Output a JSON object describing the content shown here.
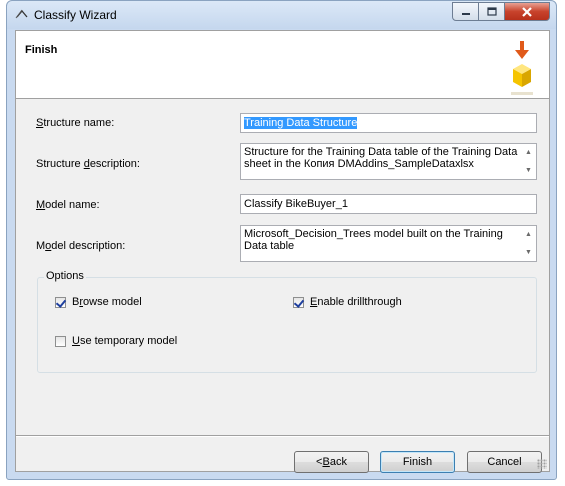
{
  "window": {
    "title": "Classify Wizard"
  },
  "page": {
    "title": "Finish"
  },
  "fields": {
    "structure_name": {
      "label_u": "S",
      "label_rest": "tructure name:",
      "value": "Training Data Structure"
    },
    "structure_description": {
      "label_pre": "Structure ",
      "label_u": "d",
      "label_rest": "escription:",
      "value": "Structure for the Training Data table of the Training Data sheet in the Копия DMAddins_SampleDataxlsx"
    },
    "model_name": {
      "label_u": "M",
      "label_rest": "odel name:",
      "value": "Classify BikeBuyer_1"
    },
    "model_description": {
      "label_pre": "M",
      "label_u": "o",
      "label_rest": "del description:",
      "value": "Microsoft_Decision_Trees model built on the Training Data table"
    }
  },
  "options": {
    "legend": "Options",
    "browse_model": {
      "label_pre": "B",
      "label_u": "r",
      "label_rest": "owse model",
      "checked": true
    },
    "enable_drillthrough": {
      "label_u": "E",
      "label_rest": "nable drillthrough",
      "checked": true
    },
    "use_temporary_model": {
      "label_u": "U",
      "label_rest": "se temporary model",
      "checked": false
    }
  },
  "buttons": {
    "back": {
      "label_pre": "< ",
      "label_u": "B",
      "label_rest": "ack"
    },
    "finish": {
      "label": "Finish"
    },
    "cancel": {
      "label": "Cancel"
    }
  },
  "icons": [
    "wizard-app-icon",
    "minimize-icon",
    "maximize-icon",
    "close-icon",
    "finish-arrow-cube-icon",
    "scroll-up-icon",
    "scroll-down-icon",
    "checkmark-icon",
    "resize-grip-icon"
  ],
  "colors": {
    "selection": "#3399ff",
    "close_button": "#c8432c",
    "arrow": "#e05a1a",
    "cube": "#f5c400"
  }
}
